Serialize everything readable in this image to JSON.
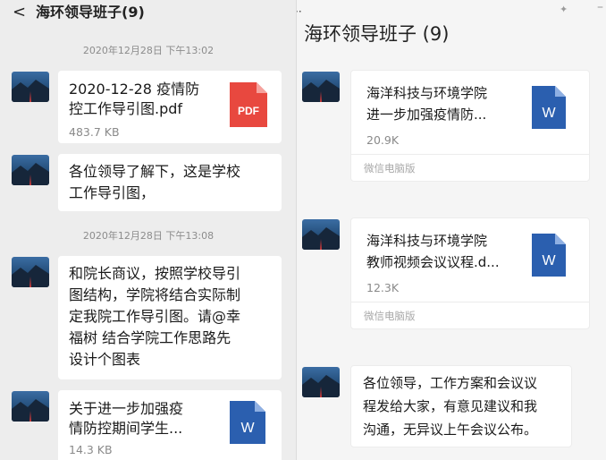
{
  "left": {
    "back_glyph": "<",
    "title": "海环领导班子(9)",
    "timestamps": [
      "2020年12月28日 下午13:02",
      "2020年12月28日 下午13:08"
    ],
    "messages": [
      {
        "type": "file",
        "name_line1": "2020-12-28 疫情防",
        "name_line2": "控工作导引图.pdf",
        "size": "483.7 KB",
        "icon": "pdf-icon",
        "icon_label": "PDF"
      },
      {
        "type": "text",
        "lines": [
          "各位领导了解下，这是学校",
          "工作导引图，"
        ]
      },
      {
        "type": "text",
        "lines": [
          "和院长商议，按照学校导引",
          "图结构，学院将结合实际制",
          "定我院工作导引图。请@幸",
          "福树  结合学院工作思路先",
          "设计个图表"
        ]
      },
      {
        "type": "file",
        "name_line1": "关于进一步加强疫",
        "name_line2": "情防控期间学生...",
        "size": "14.3 KB",
        "icon": "word-icon",
        "icon_label": "W"
      }
    ]
  },
  "right": {
    "title": "海环领导班子 (9)",
    "dots": "··",
    "messages": [
      {
        "type": "file",
        "name_line1": "海洋科技与环境学院",
        "name_line2": "进一步加强疫情防...",
        "size": "20.9K",
        "source": "微信电脑版",
        "icon": "word-icon",
        "icon_label": "W"
      },
      {
        "type": "file",
        "name_line1": "海洋科技与环境学院",
        "name_line2": "教师视频会议议程.d...",
        "size": "12.3K",
        "source": "微信电脑版",
        "icon": "word-icon",
        "icon_label": "W"
      },
      {
        "type": "text",
        "lines": [
          "各位领导，工作方案和会议议",
          "程发给大家，有意见建议和我",
          "沟通，无异议上午会议公布。"
        ]
      }
    ]
  },
  "colors": {
    "pdf": "#e8483f",
    "word": "#2b5faf",
    "panel_left": "#ededed",
    "panel_right": "#f5f5f5"
  }
}
